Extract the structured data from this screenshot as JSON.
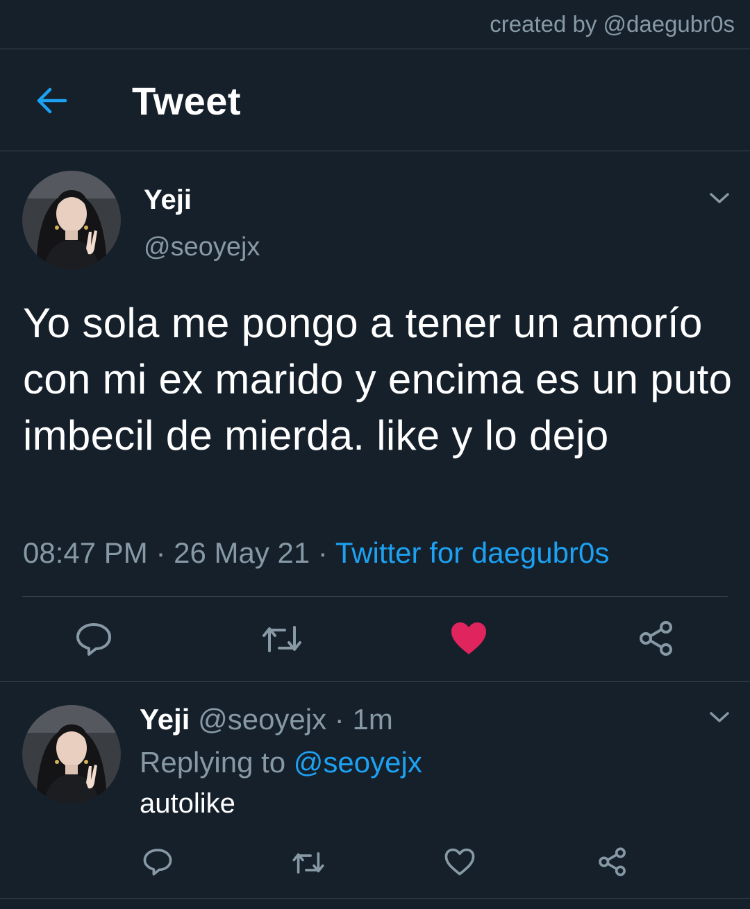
{
  "watermark": "created by @daegubr0s",
  "header": {
    "title": "Tweet",
    "back_icon": "arrow-left-icon"
  },
  "tweet": {
    "author_name": "Yeji",
    "author_handle": "@seoyejx",
    "text": "Yo sola me pongo a tener un amorío con mi ex marido y encima es un puto imbecil de mierda. like y lo dejo",
    "time": "08:47 PM",
    "date": "26 May 21",
    "separator": "·",
    "source": "Twitter for daegubr0s",
    "liked": true
  },
  "reply": {
    "author_name": "Yeji",
    "author_handle": "@seoyejx",
    "time": "1m",
    "replying_label": "Replying to",
    "replying_to": "@seoyejx",
    "text": "autolike",
    "liked": false
  },
  "colors": {
    "background": "#15202b",
    "accent": "#1da1f2",
    "muted": "#8899a6",
    "like": "#e0245e",
    "divider": "#38444d"
  },
  "icons": [
    "comment-icon",
    "retweet-icon",
    "heart-icon",
    "share-icon",
    "chevron-down-icon"
  ]
}
